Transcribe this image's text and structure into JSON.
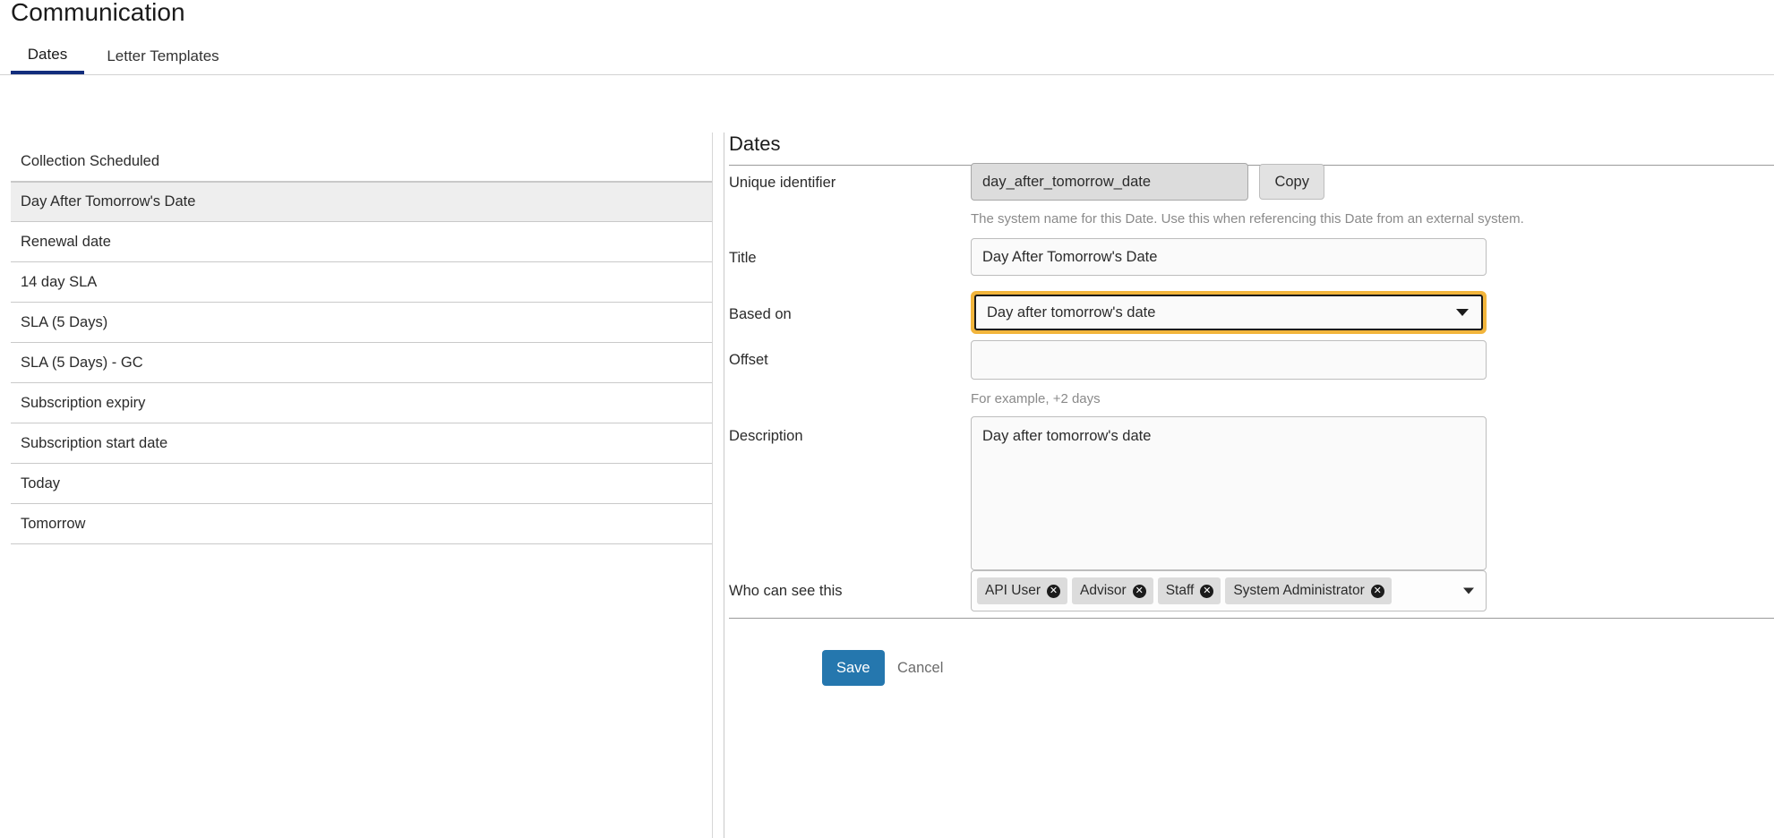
{
  "header": {
    "title": "Communication",
    "tabs": [
      {
        "label": "Dates",
        "active": true
      },
      {
        "label": "Letter Templates",
        "active": false
      }
    ]
  },
  "sidebar": {
    "items": [
      {
        "label": "Collection Scheduled",
        "selected": false
      },
      {
        "label": "Day After Tomorrow's Date",
        "selected": true
      },
      {
        "label": "Renewal date",
        "selected": false
      },
      {
        "label": "14 day SLA",
        "selected": false
      },
      {
        "label": "SLA (5 Days)",
        "selected": false
      },
      {
        "label": "SLA (5 Days) - GC",
        "selected": false
      },
      {
        "label": "Subscription expiry",
        "selected": false
      },
      {
        "label": "Subscription start date",
        "selected": false
      },
      {
        "label": "Today",
        "selected": false
      },
      {
        "label": "Tomorrow",
        "selected": false
      }
    ]
  },
  "detail": {
    "title": "Dates",
    "unique_identifier": {
      "label": "Unique identifier",
      "value": "day_after_tomorrow_date",
      "copy_label": "Copy",
      "helper": "The system name for this Date. Use this when referencing this Date from an external system."
    },
    "title_field": {
      "label": "Title",
      "value": "Day After Tomorrow's Date",
      "placeholder": ""
    },
    "based_on": {
      "label": "Based on",
      "value": "Day after tomorrow's date",
      "focused": true,
      "focus_color": "#f2b53c",
      "options": [
        "Day after tomorrow's date"
      ]
    },
    "offset": {
      "label": "Offset",
      "value": "",
      "placeholder": "",
      "helper": "For example, +2 days"
    },
    "description": {
      "label": "Description",
      "value": "Day after tomorrow's date",
      "placeholder": ""
    },
    "who_can_see_this": {
      "label": "Who can see this",
      "chips": [
        {
          "label": "API User"
        },
        {
          "label": "Advisor"
        },
        {
          "label": "Staff"
        },
        {
          "label": "System Administrator"
        }
      ]
    },
    "actions": {
      "save_label": "Save",
      "cancel_label": "Cancel",
      "save_color": "#2577ae"
    }
  }
}
